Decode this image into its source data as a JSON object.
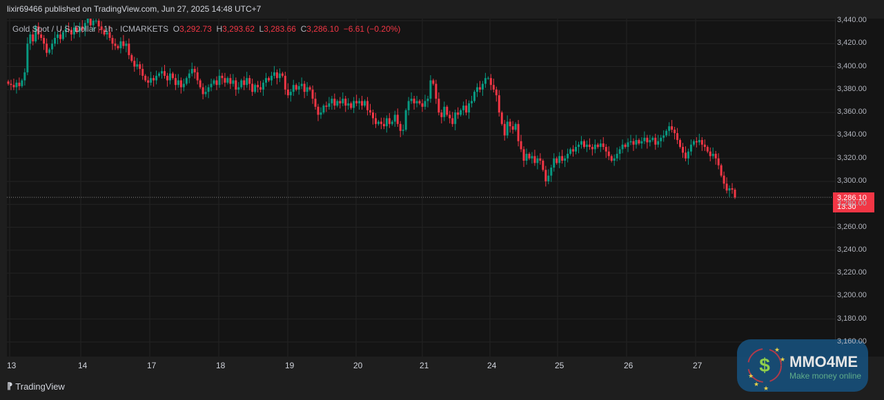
{
  "header": {
    "published": "lixir69466 published on TradingView.com, Jun 27, 2025 14:48 UTC+7"
  },
  "legend": {
    "symbol": "Gold Spot / U.S. Dollar · 1h · ICMARKETS",
    "o_label": "O",
    "o": "3,292.73",
    "h_label": "H",
    "h": "3,293.62",
    "l_label": "L",
    "l": "3,283.66",
    "c_label": "C",
    "c": "3,286.10",
    "change": "−6.61 (−0.20%)"
  },
  "price_tag": {
    "price": "3,286.10",
    "countdown": "13:30"
  },
  "footer": {
    "brand": "TradingView"
  },
  "watermark": {
    "title": "MMO4ME",
    "subtitle": "Make money online"
  },
  "colors": {
    "up": "#089981",
    "down": "#f23645",
    "background": "#141414",
    "grid": "#232323"
  },
  "chart_data": {
    "type": "candlestick",
    "ylim": [
      3150,
      3445
    ],
    "y_ticks": [
      "3,440.00",
      "3,420.00",
      "3,400.00",
      "3,380.00",
      "3,360.00",
      "3,340.00",
      "3,320.00",
      "3,300.00",
      "3,280.00",
      "3,260.00",
      "3,240.00",
      "3,220.00",
      "3,200.00",
      "3,180.00",
      "3,160.00"
    ],
    "x_ticks": [
      "13",
      "14",
      "17",
      "18",
      "19",
      "20",
      "21",
      "24",
      "25",
      "26",
      "27"
    ],
    "last_price": 3286.1,
    "closes": [
      3385,
      3384,
      3382,
      3386,
      3383,
      3388,
      3395,
      3420,
      3428,
      3422,
      3435,
      3428,
      3425,
      3420,
      3412,
      3415,
      3420,
      3425,
      3428,
      3424,
      3430,
      3433,
      3432,
      3428,
      3434,
      3430,
      3435,
      3432,
      3438,
      3442,
      3436,
      3440,
      3440,
      3435,
      3432,
      3428,
      3430,
      3425,
      3420,
      3418,
      3416,
      3422,
      3418,
      3420,
      3410,
      3405,
      3400,
      3402,
      3398,
      3392,
      3388,
      3386,
      3390,
      3388,
      3392,
      3394,
      3396,
      3392,
      3388,
      3394,
      3390,
      3384,
      3388,
      3382,
      3385,
      3390,
      3394,
      3398,
      3395,
      3388,
      3382,
      3376,
      3378,
      3382,
      3385,
      3388,
      3384,
      3392,
      3390,
      3386,
      3390,
      3385,
      3388,
      3380,
      3382,
      3388,
      3384,
      3390,
      3385,
      3378,
      3384,
      3382,
      3380,
      3386,
      3390,
      3388,
      3392,
      3395,
      3390,
      3394,
      3392,
      3380,
      3375,
      3378,
      3384,
      3380,
      3383,
      3385,
      3378,
      3382,
      3380,
      3372,
      3365,
      3358,
      3360,
      3366,
      3365,
      3368,
      3372,
      3366,
      3370,
      3368,
      3372,
      3366,
      3368,
      3364,
      3370,
      3368,
      3370,
      3366,
      3370,
      3362,
      3360,
      3355,
      3350,
      3352,
      3350,
      3348,
      3355,
      3350,
      3352,
      3358,
      3350,
      3344,
      3345,
      3362,
      3370,
      3372,
      3368,
      3370,
      3368,
      3365,
      3370,
      3372,
      3388,
      3385,
      3372,
      3360,
      3356,
      3365,
      3358,
      3355,
      3350,
      3360,
      3358,
      3362,
      3366,
      3360,
      3368,
      3370,
      3378,
      3382,
      3380,
      3385,
      3390,
      3390,
      3384,
      3380,
      3375,
      3360,
      3350,
      3340,
      3352,
      3348,
      3345,
      3350,
      3335,
      3328,
      3318,
      3324,
      3320,
      3322,
      3316,
      3320,
      3318,
      3310,
      3300,
      3305,
      3312,
      3320,
      3316,
      3322,
      3318,
      3320,
      3324,
      3328,
      3326,
      3330,
      3332,
      3335,
      3330,
      3332,
      3330,
      3328,
      3332,
      3330,
      3333,
      3330,
      3326,
      3322,
      3318,
      3320,
      3324,
      3328,
      3332,
      3330,
      3334,
      3335,
      3332,
      3336,
      3333,
      3335,
      3338,
      3334,
      3336,
      3338,
      3332,
      3335,
      3338,
      3340,
      3344,
      3348,
      3345,
      3342,
      3336,
      3330,
      3325,
      3320,
      3326,
      3332,
      3335,
      3334,
      3336,
      3332,
      3330,
      3326,
      3322,
      3324,
      3320,
      3314,
      3305,
      3298,
      3292,
      3294,
      3292.73,
      3286.1
    ]
  }
}
